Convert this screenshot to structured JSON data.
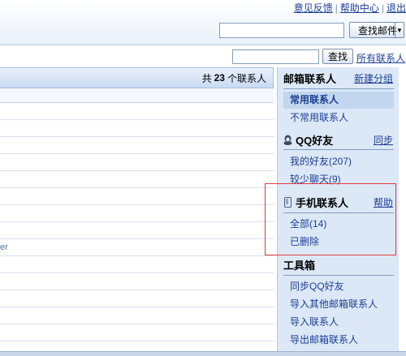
{
  "header": {
    "links": [
      "意见反馈",
      "帮助中心",
      "退出"
    ],
    "mail_search": {
      "value": "",
      "button_label": "查找邮件"
    }
  },
  "contacts": {
    "search_value": "",
    "search_button": "查找",
    "all_contacts_link": "所有联系人",
    "count_prefix": "共",
    "count": "23",
    "count_suffix": "个联系人",
    "row_fragment": "er"
  },
  "sidebar": {
    "mailbox": {
      "title": "邮箱联系人",
      "action": "新建分组",
      "items": [
        "常用联系人",
        "不常用联系人"
      ]
    },
    "qq": {
      "title": "QQ好友",
      "action": "同步",
      "items": [
        "我的好友(207)",
        "较少聊天(9)"
      ]
    },
    "phone": {
      "title": "手机联系人",
      "action": "帮助",
      "items": [
        "全部(14)",
        "已删除"
      ]
    },
    "tools": {
      "title": "工具箱",
      "items": [
        "同步QQ好友",
        "导入其他邮箱联系人",
        "导入联系人",
        "导出邮箱联系人"
      ]
    }
  },
  "colors": {
    "accent": "#1c3f94",
    "sidebar_bg": "#dce8f6",
    "highlight": "#e03a3a"
  }
}
